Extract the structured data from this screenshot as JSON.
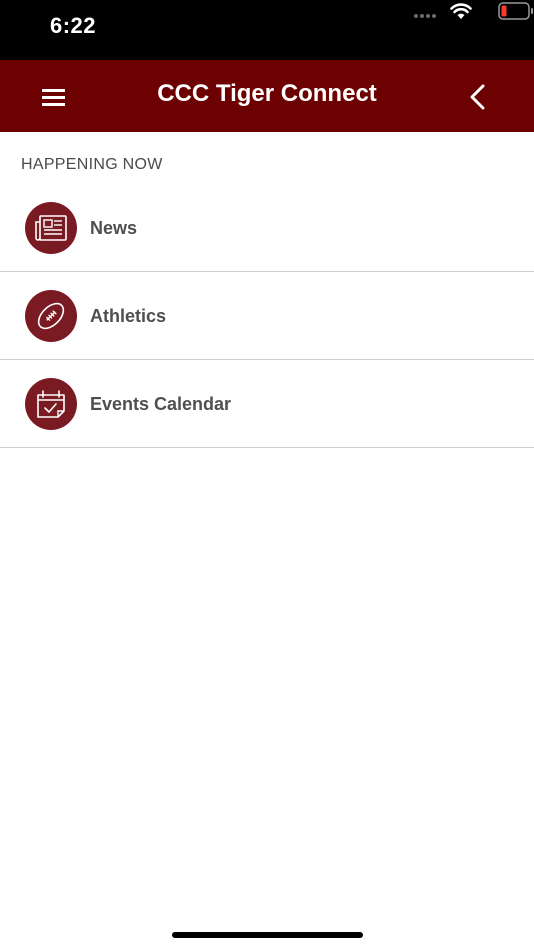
{
  "status_bar": {
    "time": "6:22",
    "icons": [
      "signal-dots-icon",
      "wifi-icon",
      "battery-low-icon"
    ]
  },
  "header": {
    "title": "CCC Tiger Connect",
    "left_icon": "hamburger-menu-icon",
    "right_icon": "chevron-left-icon",
    "background": "#6d0000"
  },
  "section": {
    "label": "HAPPENING NOW"
  },
  "menu": {
    "items": [
      {
        "label": "News",
        "icon": "newspaper-icon"
      },
      {
        "label": "Athletics",
        "icon": "football-icon"
      },
      {
        "label": "Events Calendar",
        "icon": "calendar-check-icon"
      }
    ]
  },
  "colors": {
    "accent": "#7a1a22",
    "header_bg": "#6d0000",
    "text": "#4f4f4f",
    "divider": "#cfcfcf"
  }
}
